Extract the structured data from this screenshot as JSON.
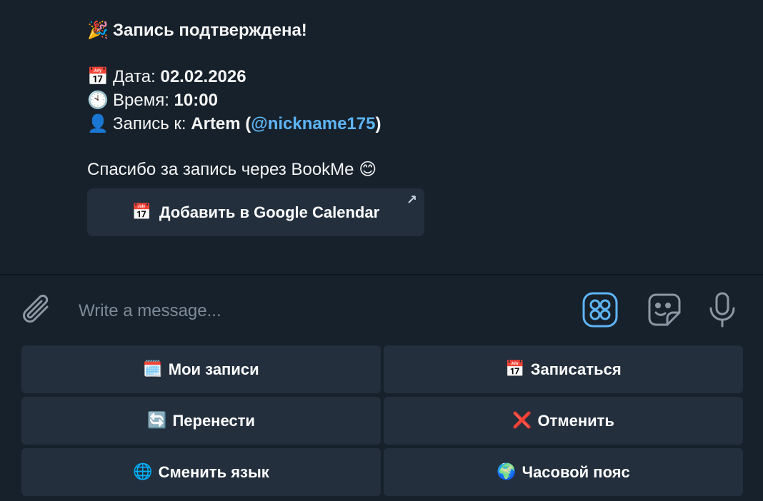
{
  "message": {
    "title_emoji": "🎉",
    "title": "Запись подтверждена!",
    "date_emoji": "📅",
    "date_label": "Дата: ",
    "date_value": "02.02.2026",
    "time_emoji": "🕙",
    "time_label": "Время: ",
    "time_value": "10:00",
    "person_emoji": "👤",
    "person_label": "Запись к: ",
    "person_name": "Artem",
    "person_open": " (",
    "person_mention": "@nickname175",
    "person_close": ")",
    "thanks": "Спасибо за запись через BookMe",
    "thanks_emoji": "😊",
    "inline_button": {
      "emoji": "📅",
      "label": "Добавить в Google Calendar",
      "arrow": "↗"
    }
  },
  "composer": {
    "placeholder": "Write a message...",
    "icons": [
      "paperclip-icon",
      "bot-menu-icon",
      "sticker-icon",
      "microphone-icon"
    ]
  },
  "keyboard": [
    {
      "emoji": "🗓️",
      "label": "Мои записи"
    },
    {
      "emoji": "📅",
      "label": "Записаться"
    },
    {
      "emoji": "🔄",
      "label": "Перенести"
    },
    {
      "emoji": "❌",
      "label": "Отменить"
    },
    {
      "emoji": "🌐",
      "label": "Сменить язык"
    },
    {
      "emoji": "🌍",
      "label": "Часовой пояс"
    }
  ],
  "colors": {
    "background": "#17212b",
    "button": "#232f3d",
    "accent": "#5eb5f7",
    "placeholder": "#7d8b99"
  }
}
